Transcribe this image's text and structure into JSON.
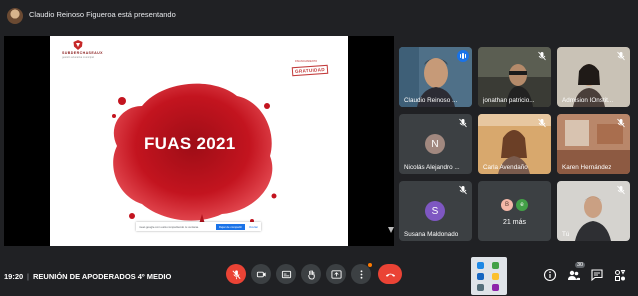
{
  "header": {
    "presenting_text": "Claudio Reinoso Figueroa está presentando"
  },
  "slide": {
    "brand": "SUBDERCHASEAUX",
    "brand_sub": "gestión educativa municipal",
    "stamp": "GRATUIDAD",
    "stamp_small": "FINANCIAMIENTO",
    "title": "FUAS 2021",
    "share_notice": {
      "text": "meet.google.com está compartiendo tu ventana.",
      "primary": "Dejar de compartir",
      "secondary": "Ocultar"
    }
  },
  "participants": [
    {
      "name": "Claudio Reinoso ...",
      "speaking": true
    },
    {
      "name": "jonathan patricio...",
      "muted": true
    },
    {
      "name": "Admision IOnstit...",
      "muted": true
    },
    {
      "name": "Nicolás Alejandro ...",
      "initial": "N",
      "muted": true
    },
    {
      "name": "Carla Avendaño",
      "muted": true
    },
    {
      "name": "Karen Hernández",
      "muted": true
    },
    {
      "name": "Susana Maldonado",
      "initial": "S",
      "muted": true
    },
    {
      "name": "21 más",
      "mini_initials": [
        "B",
        "e"
      ]
    },
    {
      "name": "Tú",
      "muted": true
    }
  ],
  "colors": {
    "background": "#202124",
    "tile": "#3c4043",
    "accent_blue": "#1a73e8",
    "leave_red": "#ea4335",
    "slide_red": "#b3121c",
    "avatar_n": "#a1887f",
    "avatar_s": "#7e57c2",
    "avatar_b": "#f5b8a8",
    "avatar_e": "#43a047"
  },
  "footer": {
    "time": "19:20",
    "separator": "|",
    "meeting_name": "REUNIÓN DE APODERADOS 4º MEDIO",
    "participant_count": "30",
    "controls": [
      {
        "icon": "mic-off-icon"
      },
      {
        "icon": "camera-icon"
      },
      {
        "icon": "captions-icon"
      },
      {
        "icon": "raise-hand-icon"
      },
      {
        "icon": "present-screen-icon"
      },
      {
        "icon": "more-options-icon"
      },
      {
        "icon": "leave-call-icon"
      }
    ],
    "right_icons": [
      "info-icon",
      "people-icon",
      "chat-icon",
      "activities-icon"
    ]
  }
}
